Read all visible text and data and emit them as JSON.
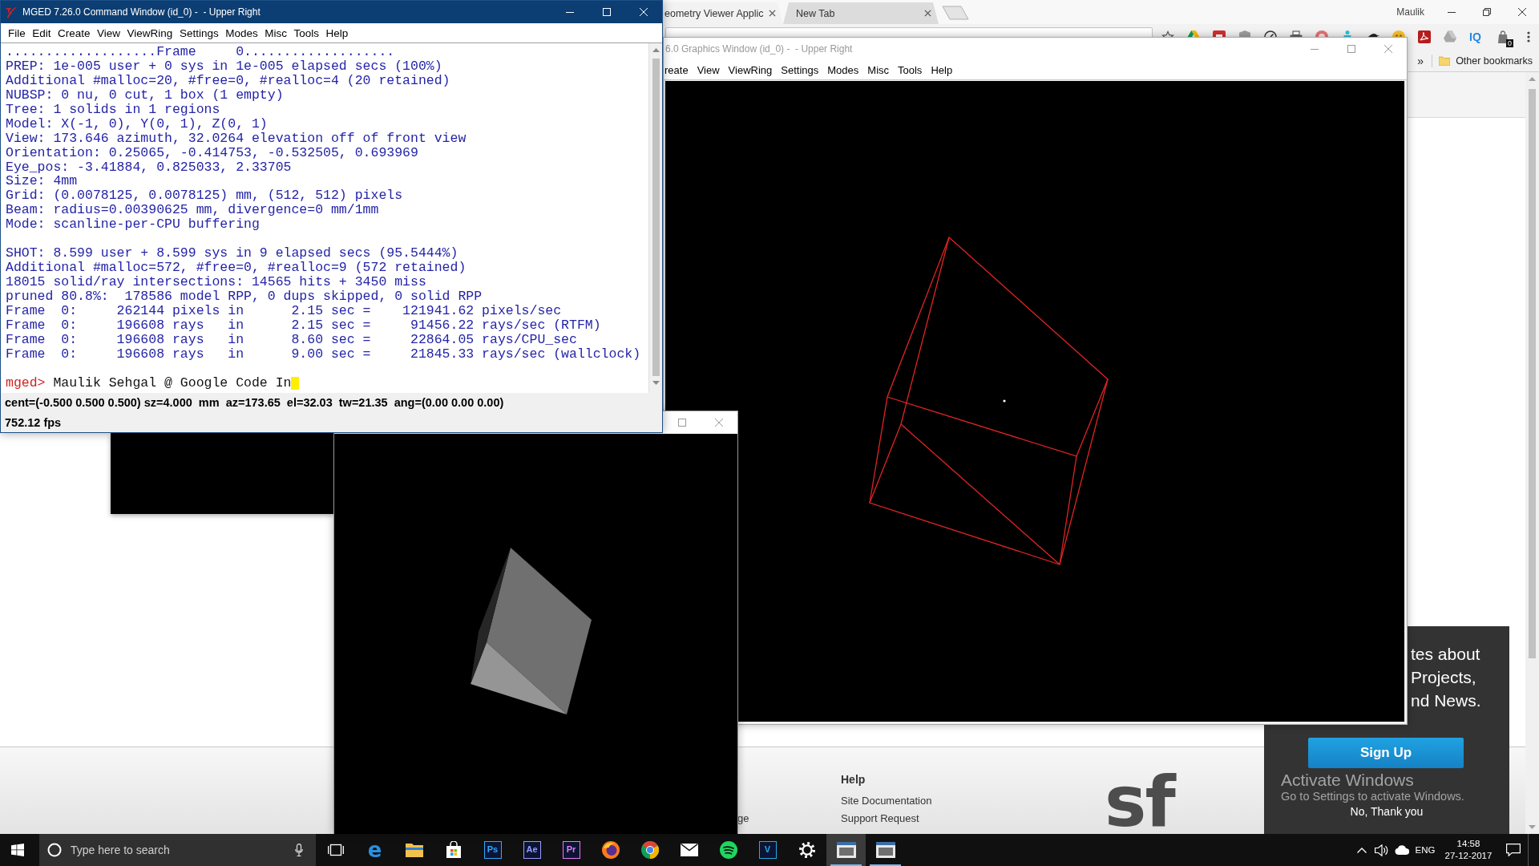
{
  "browser": {
    "tabs": [
      {
        "title": "eometry Viewer Applic",
        "selected": true
      },
      {
        "title": "New Tab",
        "selected": false
      }
    ],
    "profile": "Maulik",
    "toolbar": {
      "extension_label": "IQ",
      "extension_badge": "0"
    },
    "bookmarks": {
      "overflow": "»",
      "folder": "Other bookmarks"
    },
    "page": {
      "footer": {
        "cut_link": "ge",
        "heading": "Help",
        "links": [
          "Site Documentation",
          "Support Request"
        ],
        "logo": "sf"
      },
      "signup_popup": {
        "heading_lines": [
          "tes about",
          "Projects,",
          "nd News."
        ],
        "button": "Sign Up",
        "dismiss": "No, Thank you"
      }
    }
  },
  "graphics_window": {
    "title": "6.0 Graphics Window (id_0) -  - Upper Right",
    "menu": [
      "reate",
      "View",
      "ViewRing",
      "Settings",
      "Modes",
      "Misc",
      "Tools",
      "Help"
    ]
  },
  "command_window": {
    "title": "MGED 7.26.0 Command Window (id_0) -  - Upper Right",
    "menu": [
      "File",
      "Edit",
      "Create",
      "View",
      "ViewRing",
      "Settings",
      "Modes",
      "Misc",
      "Tools",
      "Help"
    ],
    "output_blocks": [
      [
        "...................Frame     0...................",
        "PREP: 1e-005 user + 0 sys in 1e-005 elapsed secs (100%)",
        "Additional #malloc=20, #free=0, #realloc=4 (20 retained)",
        "NUBSP: 0 nu, 0 cut, 1 box (1 empty)",
        "Tree: 1 solids in 1 regions",
        "Model: X(-1, 0), Y(0, 1), Z(0, 1)",
        "View: 173.646 azimuth, 32.0264 elevation off of front view",
        "Orientation: 0.25065, -0.414753, -0.532505, 0.693969",
        "Eye_pos: -3.41884, 0.825033, 2.33705",
        "Size: 4mm",
        "Grid: (0.0078125, 0.0078125) mm, (512, 512) pixels",
        "Beam: radius=0.00390625 mm, divergence=0 mm/1mm",
        "Mode: scanline-per-CPU buffering"
      ],
      [
        "SHOT: 8.599 user + 8.599 sys in 9 elapsed secs (95.5444%)",
        "Additional #malloc=572, #free=0, #realloc=9 (572 retained)",
        "18015 solid/ray intersections: 14565 hits + 3450 miss",
        "pruned 80.8%:  178586 model RPP, 0 dups skipped, 0 solid RPP",
        "Frame  0:     262144 pixels in      2.15 sec =    121941.62 pixels/sec",
        "Frame  0:     196608 rays   in      2.15 sec =     91456.22 rays/sec (RTFM)",
        "Frame  0:     196608 rays   in      8.60 sec =     22864.05 rays/CPU_sec",
        "Frame  0:     196608 rays   in      9.00 sec =     21845.33 rays/sec (wallclock)"
      ]
    ],
    "prompt": "mged>",
    "command": "Maulik Sehgal @ Google Code In",
    "status_lines": [
      "cent=(-0.500 0.500 0.500) sz=4.000  mm  az=173.65  el=32.03  tw=21.35  ang=(0.00 0.00 0.00)",
      "752.12 fps"
    ]
  },
  "os_notice": {
    "title": "Activate Windows",
    "subtitle": "Go to Settings to activate Windows."
  },
  "taskbar": {
    "search_placeholder": "Type here to search",
    "apps": [
      {
        "kind": "task-view",
        "selected": false,
        "running": false
      },
      {
        "kind": "letter",
        "label": "e",
        "selected": false,
        "running": false
      },
      {
        "kind": "folder",
        "selected": false,
        "running": false
      },
      {
        "kind": "bag",
        "selected": false,
        "running": false
      },
      {
        "kind": "tile",
        "label": "Ps",
        "color": "#31a8ff",
        "selected": false,
        "running": false
      },
      {
        "kind": "tile",
        "label": "Ae",
        "color": "#9999ff",
        "selected": false,
        "running": false
      },
      {
        "kind": "tile",
        "label": "Pr",
        "color": "#ea77ff",
        "selected": false,
        "running": false
      },
      {
        "kind": "fox",
        "selected": false,
        "running": false
      },
      {
        "kind": "chrome",
        "selected": false,
        "running": false
      },
      {
        "kind": "envelope",
        "selected": false,
        "running": false
      },
      {
        "kind": "spotify",
        "selected": false,
        "running": false
      },
      {
        "kind": "tile",
        "label": "V",
        "color": "#29a8e8",
        "selected": false,
        "running": false
      },
      {
        "kind": "gear",
        "selected": false,
        "running": false
      },
      {
        "kind": "window",
        "selected": true,
        "running": true
      },
      {
        "kind": "window",
        "selected": false,
        "running": true
      }
    ],
    "language": "ENG",
    "time": "14:58",
    "date": "27-12-2017"
  }
}
